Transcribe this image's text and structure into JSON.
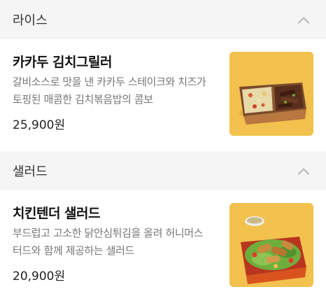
{
  "sections": [
    {
      "title": "라이스",
      "collapse_icon": "chevron-up-icon",
      "items": [
        {
          "name": "카카두 김치그릴러",
          "desc_line1": "갈비소스로 맛을 낸 카카두 스테이크와 치즈가",
          "desc_line2": "토핑된 매콤한 김치볶음밥의 콤보",
          "price": "25,900원",
          "image_icon": "rice-box-image"
        }
      ]
    },
    {
      "title": "샐러드",
      "collapse_icon": "chevron-up-icon",
      "items": [
        {
          "name": "치킨텐더 샐러드",
          "desc_line1": "부드럽고 고소한 닭안심튀김을 올려 허니머스",
          "desc_line2": "터드와 함께 제공하는 샐러드",
          "price": "20,900원",
          "image_icon": "salad-box-image"
        }
      ]
    }
  ],
  "colors": {
    "header_bg": "#f5f5f5",
    "thumb_bg": "#f2c14e",
    "chevron": "#b5b5b5"
  }
}
